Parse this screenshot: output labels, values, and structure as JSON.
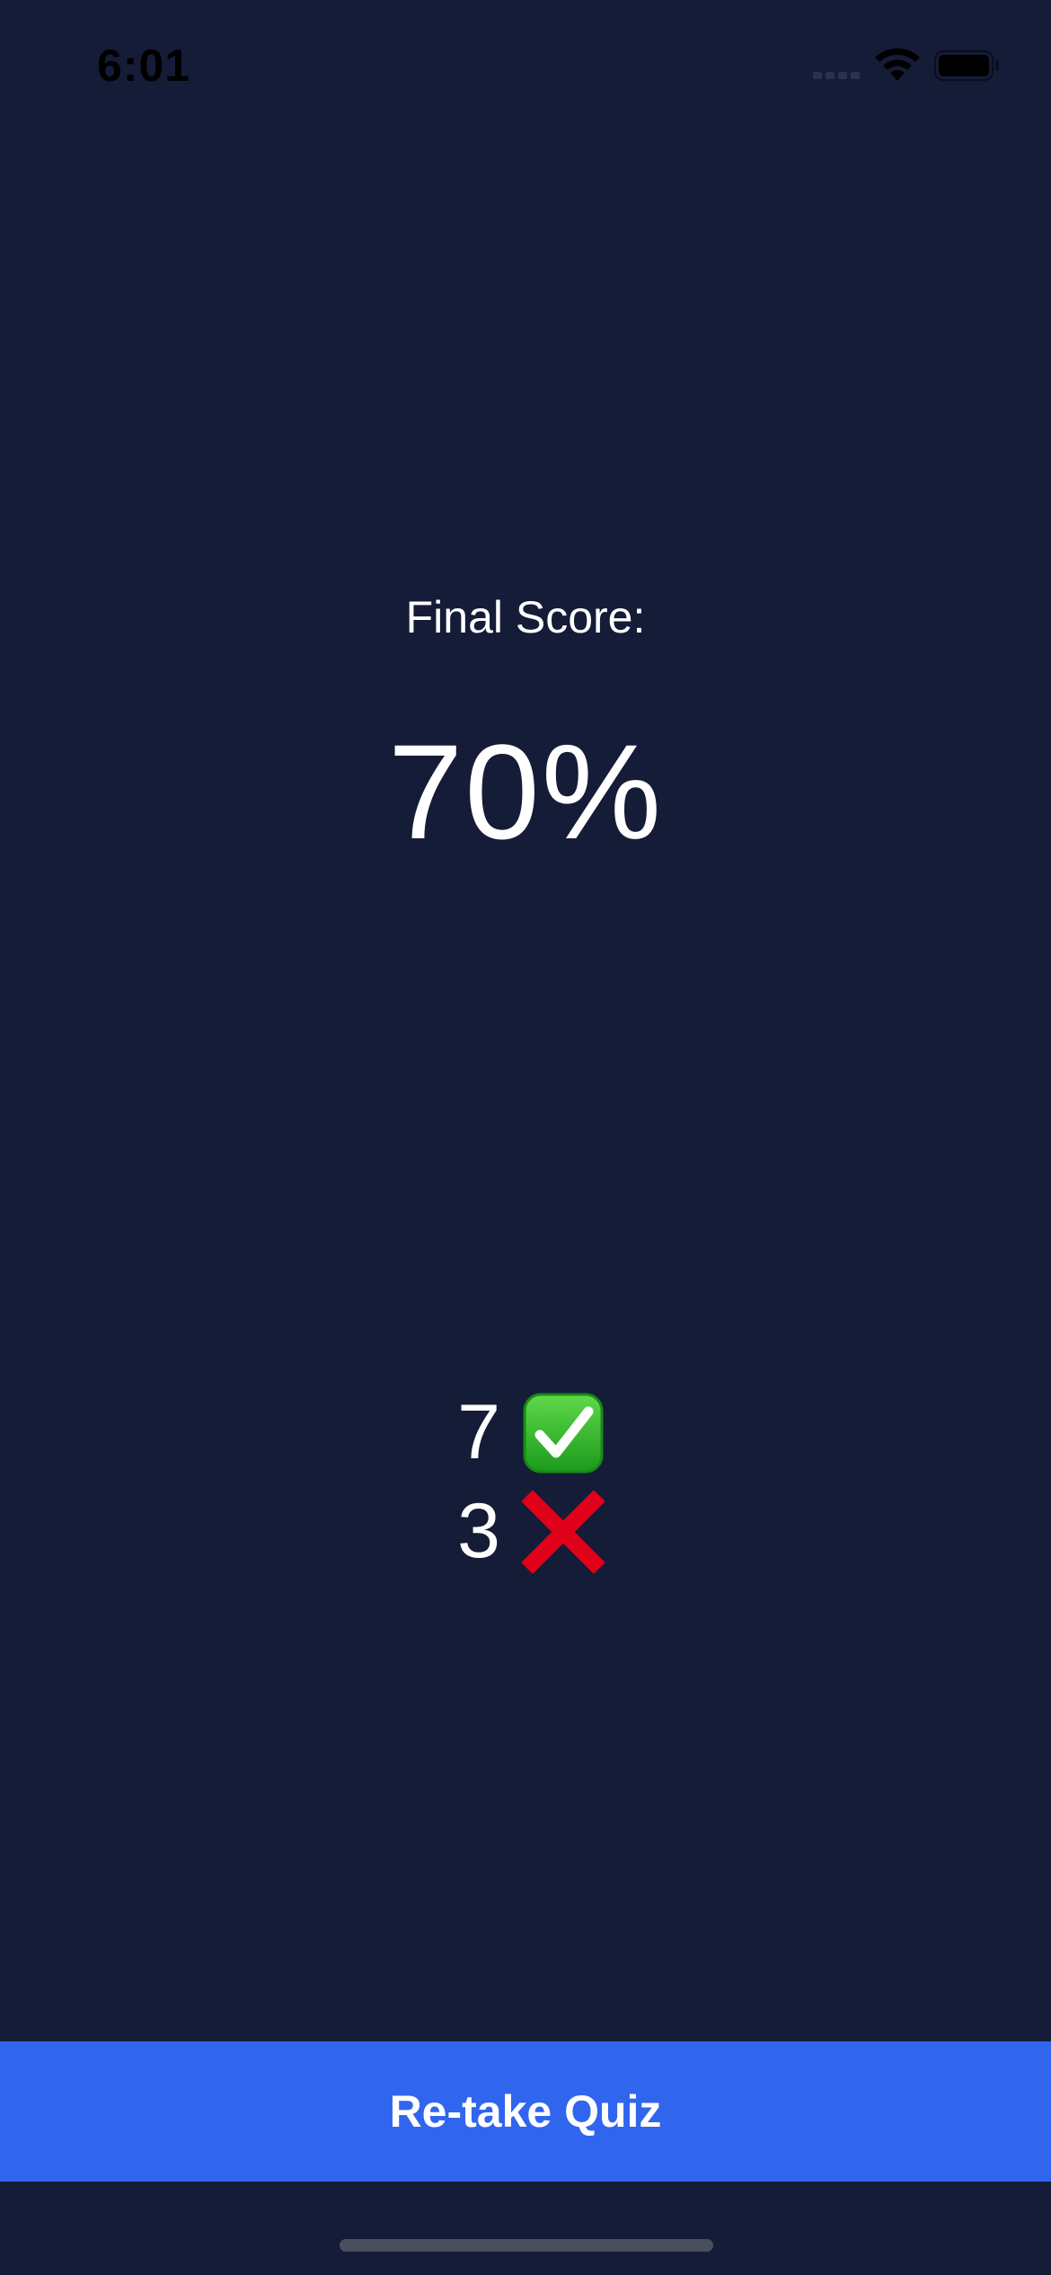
{
  "status_bar": {
    "time": "6:01",
    "wifi_icon": "wifi-icon",
    "battery_icon": "battery-icon"
  },
  "score": {
    "label": "Final Score:",
    "value": "70%"
  },
  "tally": {
    "correct_count": "7",
    "correct_icon": "check-mark-icon",
    "wrong_count": "3",
    "wrong_icon": "cross-mark-icon"
  },
  "actions": {
    "retake_label": "Re-take Quiz"
  },
  "colors": {
    "background": "#151c38",
    "button": "#3066ee",
    "check_green": "#2eb82e",
    "cross_red": "#e0001a"
  }
}
